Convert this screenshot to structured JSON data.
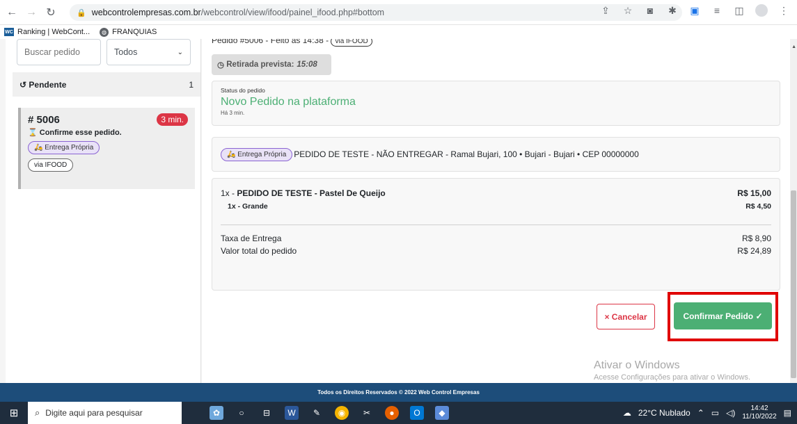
{
  "browser": {
    "url_host": "webcontrolempresas.com.br",
    "url_path": "/webcontrol/view/ifood/painel_ifood.php#bottom",
    "bookmarks": [
      {
        "label": "Ranking | WebCont..."
      },
      {
        "label": "FRANQUIAS"
      }
    ]
  },
  "sidebar": {
    "search_placeholder": "Buscar pedido",
    "filter_value": "Todos",
    "pending_label": "Pendente",
    "pending_count": "1",
    "order": {
      "number": "# 5006",
      "minutes": "3 min.",
      "confirm_text": "Confirme esse pedido.",
      "delivery_tag": "Entrega Própria",
      "source_tag": "via IFOOD"
    }
  },
  "main": {
    "clipped_title": "Pedido #5006 - Feito às 14:38 -",
    "clipped_via": "via IFOOD",
    "retirada_label": "Retirada prevista:",
    "retirada_time": "15:08",
    "status_label": "Status do pedido",
    "status_value": "Novo Pedido na plataforma",
    "status_ago": "Há 3 min.",
    "delivery_tag": "Entrega Própria",
    "address": "PEDIDO DE TESTE - NÃO ENTREGAR - Ramal Bujari, 100 • Bujari - Bujari • CEP 00000000",
    "item_qty": "1x -",
    "item_name": "PEDIDO DE TESTE - Pastel De Queijo",
    "item_price": "R$ 15,00",
    "sub_item": "1x - Grande",
    "sub_item_price": "R$ 4,50",
    "fee_label": "Taxa de Entrega",
    "fee_value": "R$ 8,90",
    "total_label": "Valor total do pedido",
    "total_value": "R$ 24,89",
    "cancel_label": "× Cancelar",
    "confirm_label": "Confirmar Pedido ✓",
    "watermark_title": "Ativar o Windows",
    "watermark_sub": "Acesse Configurações para ativar o Windows."
  },
  "footer": {
    "text": "Todos os Direitos Reservados © 2022 Web Control Empresas"
  },
  "taskbar": {
    "search_placeholder": "Digite aqui para pesquisar",
    "weather": "22°C  Nublado",
    "time": "14:42",
    "date": "11/10/2022"
  },
  "colors": {
    "accent_green": "#4caf74",
    "danger_red": "#dc3545",
    "footer_blue": "#1d4d7a",
    "highlight_red": "#e00000"
  }
}
